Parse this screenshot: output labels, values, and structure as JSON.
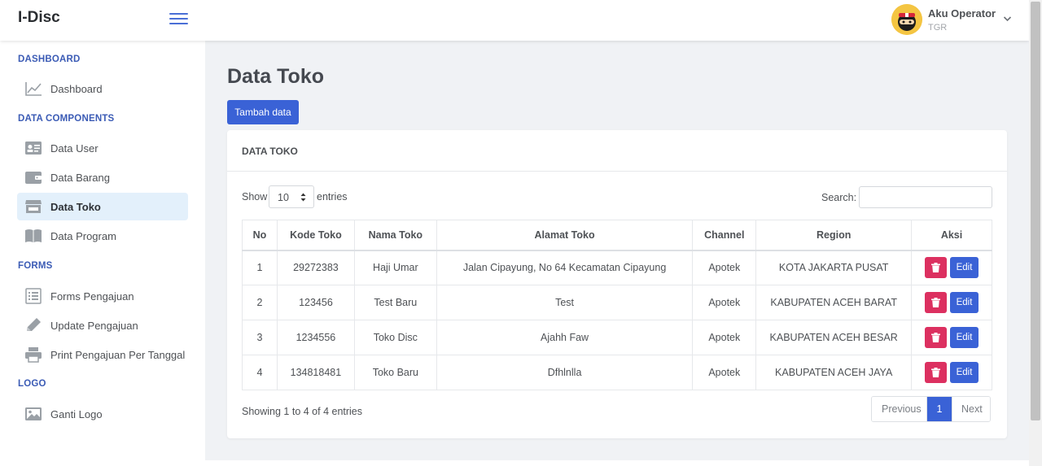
{
  "app": {
    "brand": "I-Disc"
  },
  "user": {
    "name": "Aku Operator",
    "role": "TGR"
  },
  "sidebar": {
    "sections": [
      {
        "header": "DASHBOARD",
        "items": [
          {
            "label": "Dashboard",
            "icon": "chart-line-icon"
          }
        ]
      },
      {
        "header": "DATA COMPONENTS",
        "items": [
          {
            "label": "Data User",
            "icon": "id-card-icon"
          },
          {
            "label": "Data Barang",
            "icon": "wallet-icon"
          },
          {
            "label": "Data Toko",
            "icon": "store-icon",
            "active": true
          },
          {
            "label": "Data Program",
            "icon": "book-open-icon"
          }
        ]
      },
      {
        "header": "FORMS",
        "items": [
          {
            "label": "Forms Pengajuan",
            "icon": "form-icon"
          },
          {
            "label": "Update Pengajuan",
            "icon": "pencil-icon"
          },
          {
            "label": "Print Pengajuan Per Tanggal",
            "icon": "printer-icon"
          }
        ]
      },
      {
        "header": "LOGO",
        "items": [
          {
            "label": "Ganti Logo",
            "icon": "image-icon"
          }
        ]
      }
    ]
  },
  "main": {
    "title": "Data Toko",
    "add_button": "Tambah data",
    "card_title": "DATA TOKO",
    "show_label": "Show",
    "entries_value": "10",
    "entries_label": "entries",
    "search_label": "Search:",
    "search_value": "",
    "table": {
      "headers": [
        "No",
        "Kode Toko",
        "Nama Toko",
        "Alamat Toko",
        "Channel",
        "Region",
        "Aksi"
      ],
      "rows": [
        [
          "1",
          "29272383",
          "Haji Umar",
          "Jalan Cipayung, No 64 Kecamatan Cipayung",
          "Apotek",
          "KOTA JAKARTA PUSAT"
        ],
        [
          "2",
          "123456",
          "Test Baru",
          "Test",
          "Apotek",
          "KABUPATEN ACEH BARAT"
        ],
        [
          "3",
          "1234556",
          "Toko Disc",
          "Ajahh Faw",
          "Apotek",
          "KABUPATEN ACEH BESAR"
        ],
        [
          "4",
          "134818481",
          "Toko Baru",
          "Dfhlnlla",
          "Apotek",
          "KABUPATEN ACEH JAYA"
        ]
      ],
      "edit_label": "Edit"
    },
    "info": "Showing 1 to 4 of 4 entries",
    "pagination": {
      "previous": "Previous",
      "current": "1",
      "next": "Next"
    }
  },
  "colors": {
    "primary": "#3a62d6",
    "danger": "#dc3060",
    "section_header": "#3b5bb5",
    "active_bg": "#e3f0fb"
  }
}
